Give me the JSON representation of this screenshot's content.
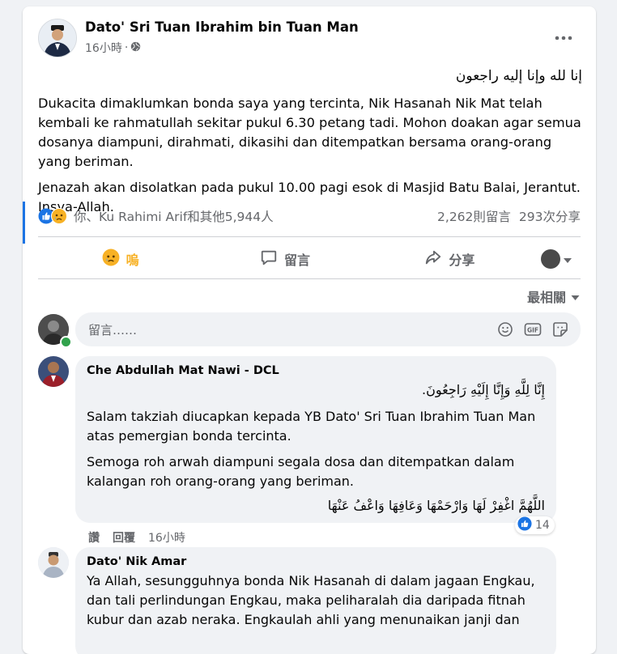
{
  "post": {
    "author": "Dato' Sri Tuan Ibrahim bin Tuan Man",
    "time": "16小時",
    "time_sep": "·",
    "arabic_line": "إنا لله وإنا إليه راجعون",
    "paragraph1": "Dukacita dimaklumkan bonda saya yang tercinta, Nik Hasanah Nik Mat telah kembali ke rahmatullah sekitar pukul 6.30 petang tadi. Mohon doakan agar semua dosanya diampuni, dirahmati, dikasihi dan ditempatkan bersama orang-orang yang beriman.",
    "paragraph2": "Jenazah akan disolatkan pada pukul 10.00 pagi esok di Masjid Batu Balai, Jerantut. Insya-Allah."
  },
  "reactions": {
    "summary": "你、Ku Rahimi Arif和其他5,944人",
    "comments": "2,262則留言",
    "shares": "293次分享"
  },
  "actions": {
    "react_label": "嗚",
    "comment_label": "留言",
    "share_label": "分享"
  },
  "sort": {
    "label": "最相關"
  },
  "composer": {
    "placeholder": "留言……"
  },
  "comments": [
    {
      "author": "Che Abdullah Mat Nawi - DCL",
      "arabic": "إِنَّا لِلَّهِ وَإِنَّا إِلَيْهِ رَاجِعُونَ.",
      "paragraph1": "Salam takziah diucapkan kepada YB Dato' Sri Tuan Ibrahim Tuan Man atas pemergian bonda tercinta.",
      "paragraph2": "Semoga roh arwah diampuni segala dosa dan ditempatkan dalam kalangan roh orang-orang yang beriman.",
      "arabic2": "اللَّهُمَّ اغْفِرْ لَهَا وَارْحَمْهَا وَعَافِهَا وَاعْفُ عَنْهَا",
      "like_label": "讚",
      "reply_label": "回覆",
      "time": "16小時",
      "like_count": "14"
    },
    {
      "author": "Dato' Nik Amar",
      "text": "Ya Allah, sesungguhnya bonda Nik Hasanah di dalam jagaan Engkau, dan tali perlindungan Engkau, maka peliharalah dia daripada fitnah kubur dan azab neraka. Engkaulah ahli yang menunaikan janji dan"
    }
  ],
  "colors": {
    "accent": "#1b74e4",
    "sad_reaction": "#f7b125",
    "online": "#31a24c"
  },
  "icons": [
    "more-icon",
    "globe-icon",
    "like-reaction-icon",
    "sad-reaction-icon",
    "comment-icon",
    "share-icon",
    "caret-down-icon",
    "emoji-icon",
    "gif-icon",
    "sticker-icon"
  ]
}
